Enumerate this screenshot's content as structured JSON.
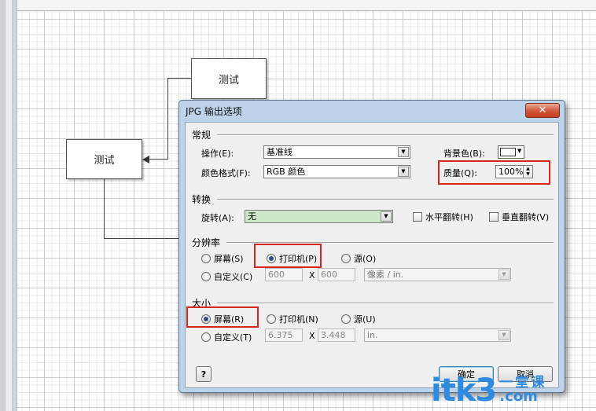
{
  "canvas": {
    "shapes": [
      {
        "label": "测试"
      },
      {
        "label": "测试"
      }
    ]
  },
  "dialog": {
    "title": "JPG 输出选项",
    "close_glyph": "✕",
    "general": {
      "section_title": "常规",
      "operation_label": "操作(E):",
      "operation_value": "基准线",
      "color_format_label": "颜色格式(F):",
      "color_format_value": "RGB 颜色",
      "background_label": "背景色(B):",
      "quality_label": "质量(Q):",
      "quality_value": "100%"
    },
    "transform": {
      "section_title": "转换",
      "rotate_label": "旋转(A):",
      "rotate_value": "无",
      "rotate_field_color": "#cde8c9",
      "flip_h_label": "水平翻转(H)",
      "flip_v_label": "垂直翻转(V)"
    },
    "resolution": {
      "section_title": "分辨率",
      "screen_label": "屏幕(S)",
      "printer_label": "打印机(P)",
      "source_label": "源(O)",
      "custom_label": "自定义(C)",
      "width_value": "600",
      "x_label": "X",
      "height_value": "600",
      "unit_value": "像素 / in.",
      "selected": "printer"
    },
    "size": {
      "section_title": "大小",
      "screen_label": "屏幕(R)",
      "printer_label": "打印机(N)",
      "source_label": "源(U)",
      "custom_label": "自定义(T)",
      "width_value": "6.375",
      "x_label": "X",
      "height_value": "3.448",
      "unit_value": "in.",
      "selected": "screen"
    },
    "help_glyph": "?",
    "ok_label": "确定",
    "cancel_label": "取消"
  },
  "watermark": {
    "main": "itk3",
    "cn": "一堂课",
    "domain": ".com"
  },
  "colors": {
    "highlight": "#d8261d",
    "dialog_frame": "#bcd3ea",
    "watermark": "#2f8be0"
  }
}
